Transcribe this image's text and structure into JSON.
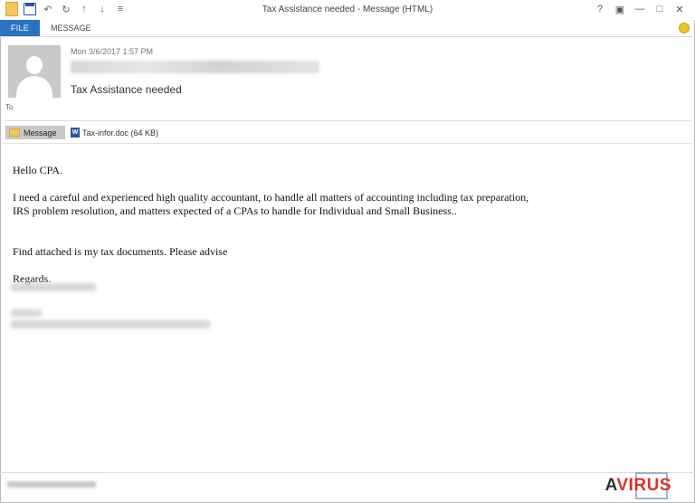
{
  "window": {
    "title": "Tax Assistance needed - Message (HTML)",
    "controls": [
      "?",
      "▣",
      "—",
      "□",
      "✕"
    ]
  },
  "ribbon": {
    "file_tab": "FILE",
    "message_tab": "MESSAGE"
  },
  "header": {
    "date": "Mon 3/6/2017 1:57 PM",
    "subject": "Tax Assistance needed",
    "to_label": "To"
  },
  "attachments": {
    "message_label": "Message",
    "file_label": "Tax-infor.doc (64 KB)",
    "file_icon": "W"
  },
  "body": {
    "greeting": "Hello CPA.",
    "line1": "I need a careful and experienced high quality accountant, to handle all matters of accounting including tax preparation,",
    "line2": "IRS problem resolution, and matters expected of a CPAs to handle for Individual and Small Business..",
    "line3": "Find attached is my tax documents. Please advise",
    "regards": "Regards."
  },
  "watermark": {
    "a": "A",
    "rest": "VIRUS",
    "color": "#d9332d"
  },
  "colors": {
    "file_tab": "#2b72c2",
    "avatar_bg": "#c9c9c9"
  }
}
